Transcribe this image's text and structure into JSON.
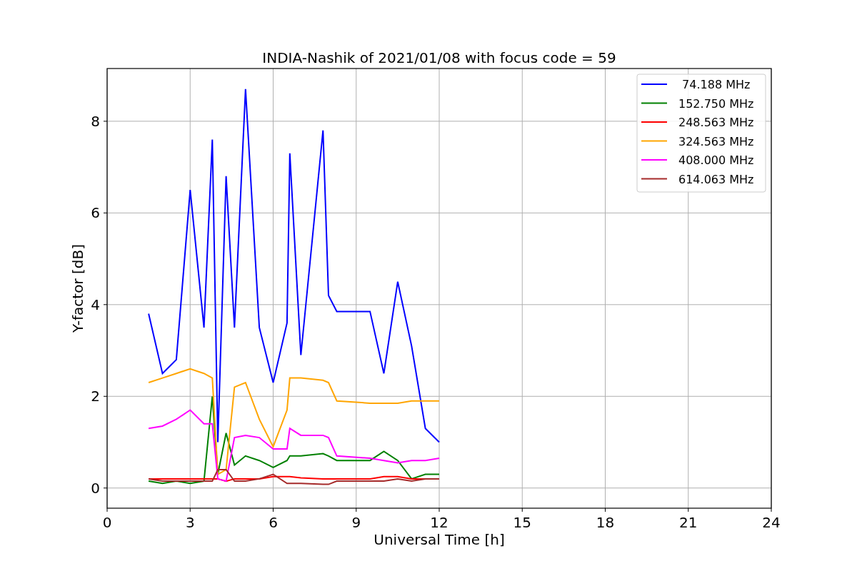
{
  "chart_data": {
    "type": "line",
    "title": "INDIA-Nashik of 2021/01/08 with focus code = 59",
    "xlabel": "Universal Time [h]",
    "ylabel": "Y-factor [dB]",
    "x": [
      1.5,
      2,
      2.5,
      3,
      3.5,
      3.8,
      4,
      4.3,
      4.6,
      5,
      5.5,
      6,
      6.5,
      6.6,
      7,
      7.8,
      8,
      8.3,
      9.5,
      10,
      10.5,
      11,
      11.5,
      12
    ],
    "series": [
      {
        "name": " 74.188 MHz",
        "color": "#0000ff",
        "values": [
          3.8,
          2.5,
          2.8,
          6.5,
          3.5,
          7.6,
          1.0,
          6.8,
          3.5,
          8.7,
          3.5,
          2.3,
          3.6,
          7.3,
          2.9,
          7.8,
          4.2,
          3.85,
          3.85,
          2.5,
          4.5,
          3.1,
          1.3,
          1.0
        ]
      },
      {
        "name": "152.750 MHz",
        "color": "#008000",
        "values": [
          0.15,
          0.1,
          0.15,
          0.1,
          0.15,
          2.0,
          0.3,
          1.2,
          0.5,
          0.7,
          0.6,
          0.45,
          0.6,
          0.7,
          0.7,
          0.75,
          0.7,
          0.6,
          0.6,
          0.8,
          0.6,
          0.2,
          0.3,
          0.3
        ]
      },
      {
        "name": "248.563 MHz",
        "color": "#ff0000",
        "values": [
          0.2,
          0.2,
          0.2,
          0.2,
          0.2,
          0.2,
          0.2,
          0.15,
          0.2,
          0.2,
          0.2,
          0.25,
          0.25,
          0.25,
          0.22,
          0.2,
          0.2,
          0.2,
          0.2,
          0.25,
          0.25,
          0.2,
          0.2,
          0.2
        ]
      },
      {
        "name": "324.563 MHz",
        "color": "#ffa500",
        "values": [
          2.3,
          2.4,
          2.5,
          2.6,
          2.5,
          2.4,
          0.3,
          0.4,
          2.2,
          2.3,
          1.5,
          0.9,
          1.7,
          2.4,
          2.4,
          2.35,
          2.3,
          1.9,
          1.85,
          1.85,
          1.85,
          1.9,
          1.9,
          1.9
        ]
      },
      {
        "name": "408.000 MHz",
        "color": "#ff00ff",
        "values": [
          1.3,
          1.35,
          1.5,
          1.7,
          1.4,
          1.4,
          0.2,
          0.15,
          1.1,
          1.15,
          1.1,
          0.85,
          0.85,
          1.3,
          1.15,
          1.15,
          1.1,
          0.7,
          0.65,
          0.6,
          0.55,
          0.6,
          0.6,
          0.65
        ]
      },
      {
        "name": "614.063 MHz",
        "color": "#a52a2a",
        "values": [
          0.2,
          0.15,
          0.15,
          0.15,
          0.15,
          0.15,
          0.4,
          0.4,
          0.15,
          0.15,
          0.2,
          0.3,
          0.1,
          0.1,
          0.1,
          0.08,
          0.08,
          0.15,
          0.15,
          0.15,
          0.2,
          0.15,
          0.2,
          0.2
        ]
      }
    ],
    "xlim": [
      0,
      24
    ],
    "ylim": [
      -0.44,
      9.15
    ],
    "xticks": [
      0,
      3,
      6,
      9,
      12,
      15,
      18,
      21,
      24
    ],
    "yticks": [
      0,
      2,
      4,
      6,
      8
    ],
    "grid": true,
    "legend": true
  }
}
